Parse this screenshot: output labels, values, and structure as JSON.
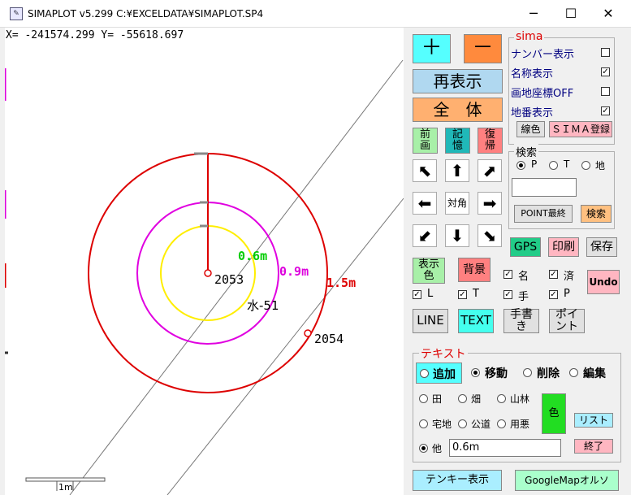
{
  "window": {
    "title": "SIMAPLOT v5.299  C:¥EXCELDATA¥SIMAPLOT.SP4",
    "app_icon": "simaplot-app-icon",
    "minimize": "─",
    "maximize": "☐",
    "close": "✕"
  },
  "coords": "X= -241574.299 Y=  -55618.697",
  "map": {
    "labels": {
      "p2053": "2053",
      "p2054": "2054",
      "r06": "0.6m",
      "r09": "0.9m",
      "r15": "1.5m",
      "mizu": "水-51",
      "scale": "1m"
    },
    "colors": {
      "r06": "#00cc00",
      "r09": "#dd00dd",
      "r15": "#dd0000",
      "circle_yellow": "#ffee00",
      "circle_magenta": "#e000e0",
      "circle_red": "#dd0000"
    }
  },
  "toolbar": {
    "zoom_in": "＋",
    "zoom_out": "－",
    "redraw": "再表示",
    "fit_all": "全　体",
    "prev_view": "前\n画",
    "memory": "記\n憶",
    "restore": "復\n帰",
    "arrows": {
      "nw": "⬉",
      "n": "⬆",
      "ne": "⬈",
      "w": "⬅",
      "center": "対角",
      "e": "➡",
      "sw": "⬋",
      "s": "⬇",
      "se": "⬊"
    },
    "display_color": "表示\n色",
    "background": "背景",
    "gps": "GPS",
    "print": "印刷",
    "save": "保存",
    "undo": "Undo",
    "line": "LINE",
    "text": "TEXT",
    "handwriting": "手書\nき",
    "point": "ポイ\nント",
    "tenkey": "テンキー表示",
    "googlemap": "GoogleMapオルソ"
  },
  "checks": {
    "name": {
      "label": "名",
      "checked": true
    },
    "done": {
      "label": "済",
      "checked": true
    },
    "L": {
      "label": "L",
      "checked": true
    },
    "T": {
      "label": "T",
      "checked": true
    },
    "hand": {
      "label": "手",
      "checked": true
    },
    "P": {
      "label": "P",
      "checked": true
    }
  },
  "sima": {
    "title": "sima",
    "options": [
      {
        "label": "ナンバー表示",
        "checked": false
      },
      {
        "label": "名称表示",
        "checked": true
      },
      {
        "label": "画地座標OFF",
        "checked": false
      },
      {
        "label": "地番表示",
        "checked": true
      }
    ],
    "line_color": "線色",
    "register": "ＳＩＭＡ登録"
  },
  "search": {
    "title": "検索",
    "radios": [
      {
        "label": "P",
        "selected": true
      },
      {
        "label": "T",
        "selected": false
      },
      {
        "label": "地",
        "selected": false
      }
    ],
    "input_value": "",
    "last_point": "POINT最終",
    "search_button": "検索"
  },
  "text_panel": {
    "title": "テキスト",
    "modes": [
      {
        "label": "追加",
        "selected": false
      },
      {
        "label": "移動",
        "selected": true
      },
      {
        "label": "削除",
        "selected": false
      },
      {
        "label": "編集",
        "selected": false
      }
    ],
    "types_row1": [
      "田",
      "畑",
      "山林"
    ],
    "types_row2": [
      "宅地",
      "公道",
      "用悪"
    ],
    "other": "他",
    "other_selected": true,
    "value": "0.6m",
    "color": "色",
    "list": "リスト",
    "end": "終了"
  }
}
